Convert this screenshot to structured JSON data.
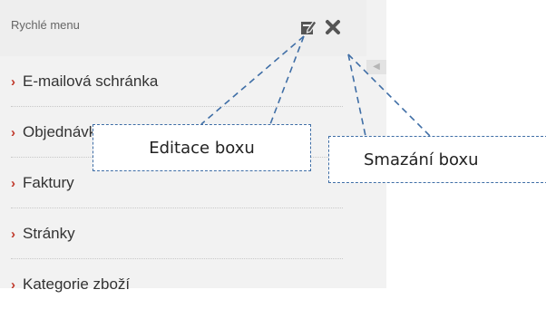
{
  "panel": {
    "title": "Rychlé menu",
    "icons": {
      "edit": "pencil-edit-icon",
      "close": "close-x-icon"
    },
    "items": [
      {
        "label": "E-mailová schránka"
      },
      {
        "label": "Objednávky"
      },
      {
        "label": "Faktury"
      },
      {
        "label": "Stránky"
      },
      {
        "label": "Kategorie zboží"
      }
    ],
    "chevron": "›"
  },
  "annotations": {
    "edit": "Editace boxu",
    "delete": "Smazání boxu"
  },
  "colors": {
    "accent_chevron": "#c0392b",
    "callout_border": "#3f6ea6",
    "panel_bg": "#f2f2f2"
  }
}
